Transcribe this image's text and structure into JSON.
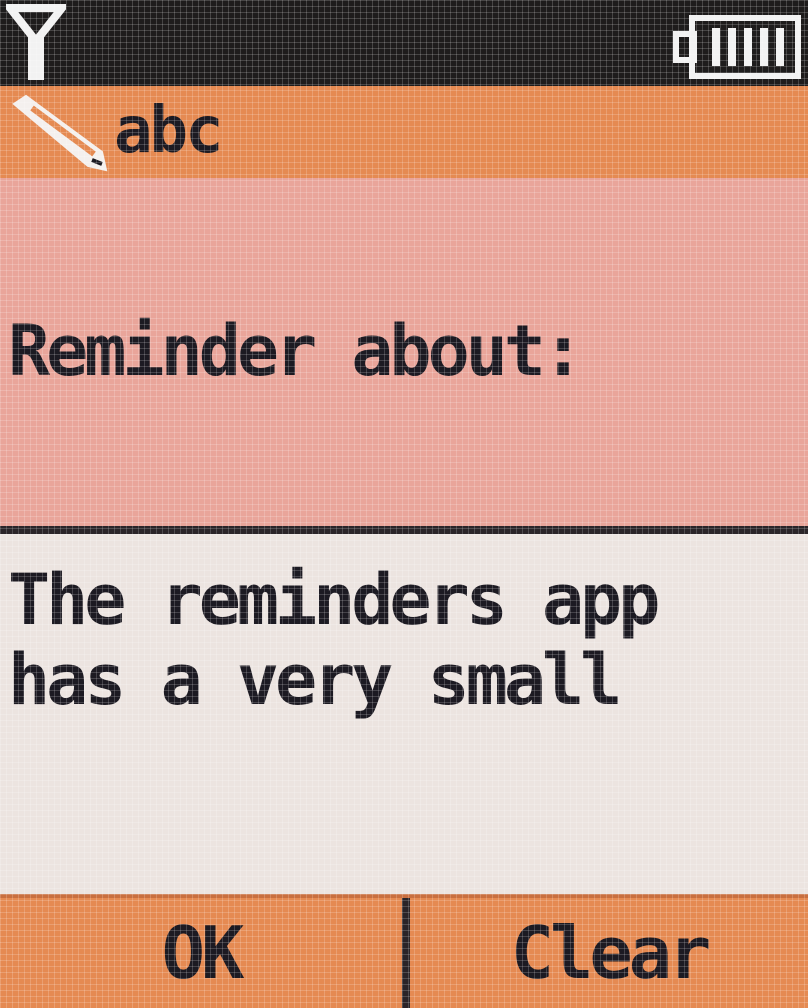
{
  "status_bar": {
    "signal_icon": "antenna-signal-icon",
    "battery_icon": "battery-icon",
    "battery_level": 1.0
  },
  "title_bar": {
    "edit_icon": "pencil-icon",
    "input_mode": "abc"
  },
  "form": {
    "prompt_label": "Reminder about:",
    "text_lines": [
      "The reminders app",
      "has a very small"
    ]
  },
  "softkeys": {
    "left_label": "OK",
    "right_label": "Clear"
  },
  "colors": {
    "accent": "#e58a52",
    "label_background": "#e9a59a",
    "text_background": "#ece4e0",
    "text": "#1c1a22"
  }
}
